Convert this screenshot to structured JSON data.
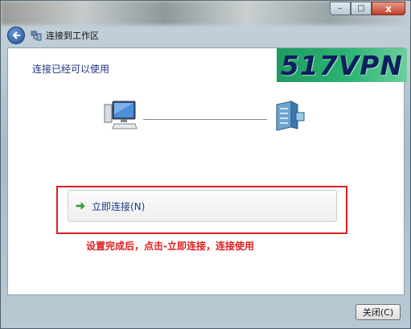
{
  "window": {
    "title": "连接到工作区",
    "close_glyph": "x",
    "minimize_glyph": "–",
    "maximize_glyph": "□"
  },
  "content": {
    "headline": "连接已经可以使用",
    "logo_text": "517VPN",
    "connect_label": "立即连接(N)",
    "note": "设置完成后，点击-立即连接，连接使用"
  },
  "footer": {
    "close_label": "关闭(C)"
  },
  "colors": {
    "accent_red": "#d92020",
    "link_blue": "#1a3a8a",
    "logo_green": "#2cb474"
  },
  "icons": [
    "back-arrow-icon",
    "network-icon",
    "computer-icon",
    "server-icon",
    "green-arrow-icon"
  ]
}
